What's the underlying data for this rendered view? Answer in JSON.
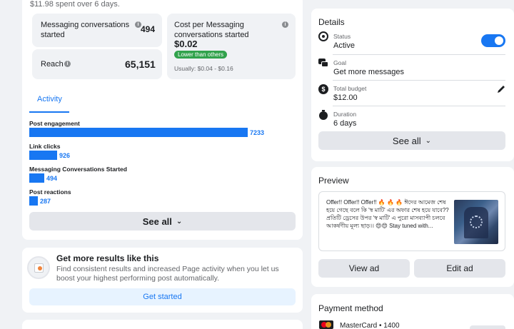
{
  "summary": {
    "spent_text": "$11.98 spent over 6 days."
  },
  "metrics": {
    "messaging_label": "Messaging conversations started",
    "messaging_value": "494",
    "cost_label": "Cost per Messaging conversations started",
    "cost_value": "$0.02",
    "cost_badge": "Lower than others",
    "cost_usual": "Usually: $0.04 - $0.16",
    "reach_label": "Reach",
    "reach_value": "65,151"
  },
  "activity": {
    "tab_label": "Activity",
    "see_all": "See all",
    "bars": [
      {
        "label": "Post engagement",
        "value": 7233,
        "value_text": "7233"
      },
      {
        "label": "Link clicks",
        "value": 926,
        "value_text": "926"
      },
      {
        "label": "Messaging Conversations Started",
        "value": 494,
        "value_text": "494"
      },
      {
        "label": "Post reactions",
        "value": 287,
        "value_text": "287"
      }
    ],
    "max_value": 7233
  },
  "promo": {
    "title": "Get more results like this",
    "body": "Find consistent results and increased Page activity when you let us boost your highest performing post automatically.",
    "button": "Get started"
  },
  "details": {
    "title": "Details",
    "status_label": "Status",
    "status_value": "Active",
    "status_on": true,
    "goal_label": "Goal",
    "goal_value": "Get more messages",
    "budget_label": "Total budget",
    "budget_value": "$12.00",
    "duration_label": "Duration",
    "duration_value": "6 days",
    "see_all": "See all"
  },
  "preview": {
    "title": "Preview",
    "post_text": "Offer!! Offer!! Offer!! 🔥 🔥 🔥 ঈদের আমেজ শেষ হয়ে গেছে বলে কি 'স্ব মাটি' এর অফার শেষ হয়ে যাবে?? প্রতিটি ড্রেসের উপর 'স্ব মাটি' এ পুরো মাসব্যাপী চলবে আকর্ষণীয় মূল্য ছাড়।। 😍😍 Stay tuned with...",
    "view_button": "View ad",
    "edit_button": "Edit ad"
  },
  "payment": {
    "title": "Payment method",
    "card_text": "MasterCard • 1400"
  },
  "colors": {
    "accent": "#1877f2",
    "badge": "#31a24c"
  }
}
